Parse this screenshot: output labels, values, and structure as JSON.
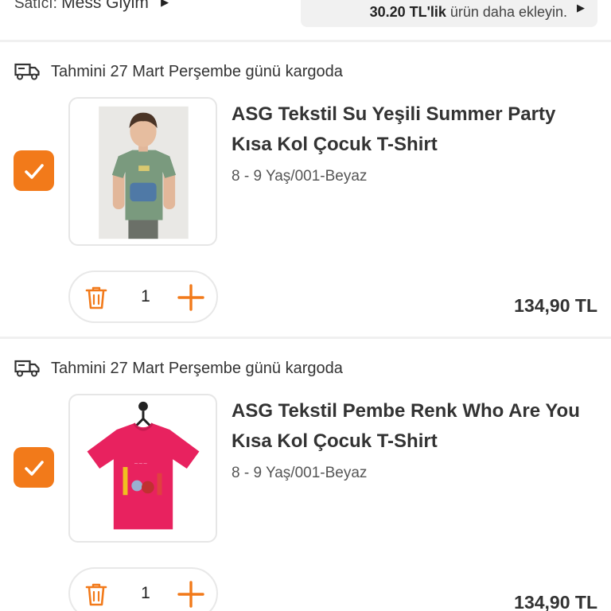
{
  "seller": {
    "label": "Satıcı:",
    "name": "Mess Giyim"
  },
  "promo": {
    "amount": "30.20 TL'lik",
    "text": " ürün daha ekleyin."
  },
  "colors": {
    "accent": "#f27a1a",
    "divider": "#f0f0f0"
  },
  "items": [
    {
      "shipping": "Tahmini 27 Mart Perşembe günü kargoda",
      "checked": true,
      "image": "boy-green-tshirt-photo",
      "title": "ASG Tekstil Su Yeşili Summer Party Kısa Kol Çocuk T-Shirt",
      "variant": "8 - 9 Yaş/001-Beyaz",
      "quantity": "1",
      "price": "134,90 TL"
    },
    {
      "shipping": "Tahmini 27 Mart Perşembe günü kargoda",
      "checked": true,
      "image": "pink-tshirt-photo",
      "title": "ASG Tekstil Pembe Renk Who Are You Kısa Kol Çocuk T-Shirt",
      "variant": "8 - 9 Yaş/001-Beyaz",
      "quantity": "1",
      "price": "134,90 TL"
    }
  ]
}
